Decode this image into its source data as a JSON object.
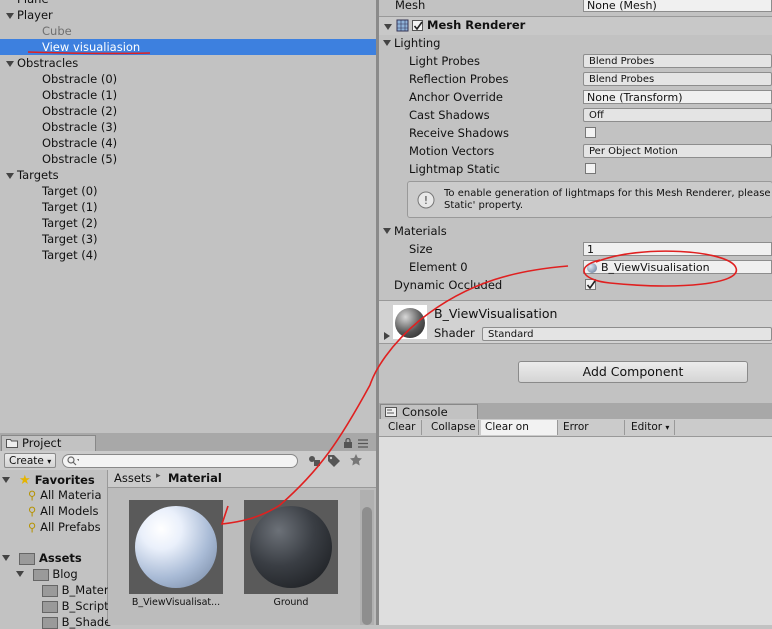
{
  "hierarchy": {
    "items": [
      {
        "label": "Plane",
        "indent": 1
      },
      {
        "label": "Player",
        "indent": 1,
        "expanded": true
      },
      {
        "label": "Cube",
        "indent": 2
      },
      {
        "label": "View visualiasion",
        "indent": 2,
        "selected": true
      },
      {
        "label": "Obstracles",
        "indent": 1,
        "expanded": true
      },
      {
        "label": "Obstracle (0)",
        "indent": 2
      },
      {
        "label": "Obstracle (1)",
        "indent": 2
      },
      {
        "label": "Obstracle (2)",
        "indent": 2
      },
      {
        "label": "Obstracle (3)",
        "indent": 2
      },
      {
        "label": "Obstracle (4)",
        "indent": 2
      },
      {
        "label": "Obstracle (5)",
        "indent": 2
      },
      {
        "label": "Targets",
        "indent": 1,
        "expanded": true
      },
      {
        "label": "Target (0)",
        "indent": 2
      },
      {
        "label": "Target (1)",
        "indent": 2
      },
      {
        "label": "Target (2)",
        "indent": 2
      },
      {
        "label": "Target (3)",
        "indent": 2
      },
      {
        "label": "Target (4)",
        "indent": 2
      }
    ]
  },
  "inspector": {
    "mesh_label": "Mesh",
    "mesh_value": "None (Mesh)",
    "component_title": "Mesh Renderer",
    "lighting_label": "Lighting",
    "light_probes_label": "Light Probes",
    "light_probes_value": "Blend Probes",
    "reflection_probes_label": "Reflection Probes",
    "reflection_probes_value": "Blend Probes",
    "anchor_override_label": "Anchor Override",
    "anchor_override_value": "None (Transform)",
    "cast_shadows_label": "Cast Shadows",
    "cast_shadows_value": "Off",
    "receive_shadows_label": "Receive Shadows",
    "motion_vectors_label": "Motion Vectors",
    "motion_vectors_value": "Per Object Motion",
    "lightmap_static_label": "Lightmap Static",
    "info_line1": "To enable generation of lightmaps for this Mesh Renderer, please",
    "info_line2": "Static' property.",
    "materials_label": "Materials",
    "size_label": "Size",
    "size_value": "1",
    "element0_label": "Element 0",
    "element0_value": "B_ViewVisualisation",
    "dynamic_occluded_label": "Dynamic Occluded",
    "material_name": "B_ViewVisualisation",
    "shader_label": "Shader",
    "shader_value": "Standard",
    "add_component_label": "Add Component"
  },
  "console": {
    "tab_label": "Console",
    "buttons": [
      "Clear",
      "Collapse",
      "Clear on Play",
      "Error Pause",
      "Editor"
    ]
  },
  "project": {
    "tab_label": "Project",
    "create_label": "Create",
    "favorites_label": "Favorites",
    "favorites": [
      "All Materia",
      "All Models",
      "All Prefabs"
    ],
    "assets_label": "Assets",
    "tree": [
      "Blog",
      "B_Mater",
      "B_Script",
      "B_Shade"
    ],
    "breadcrumb_root": "Assets",
    "breadcrumb_current": "Material",
    "thumbs": [
      {
        "label": "B_ViewVisualisat..."
      },
      {
        "label": "Ground"
      }
    ]
  }
}
